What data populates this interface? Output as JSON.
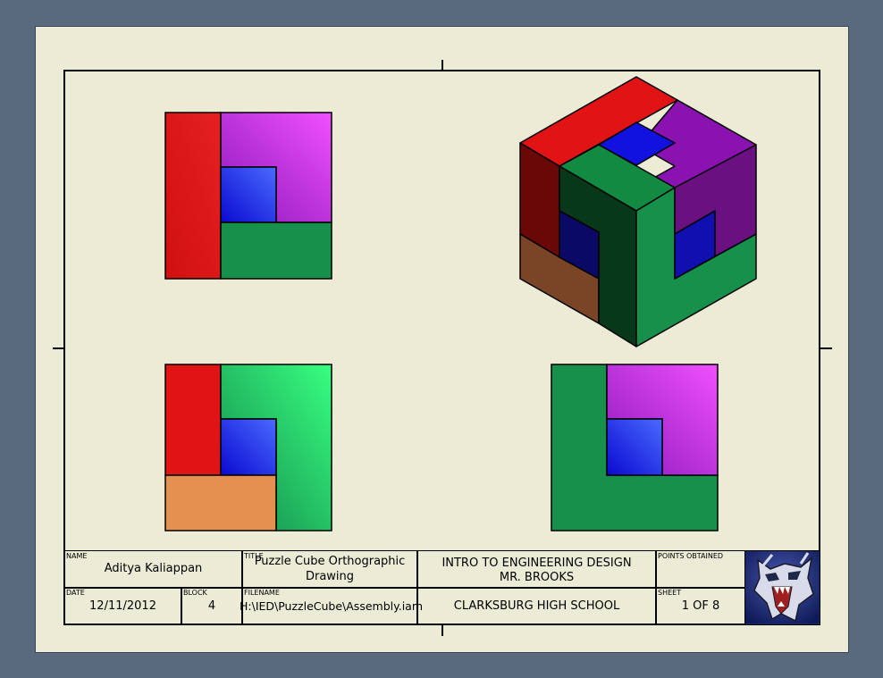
{
  "title_block": {
    "name_caption": "NAME",
    "name": "Aditya Kaliappan",
    "title_caption": "TITLE",
    "title_line1": "Puzzle Cube Orthographic",
    "title_line2": "Drawing",
    "course_line1": "INTRO TO ENGINEERING DESIGN",
    "course_line2": "MR. BROOKS",
    "points_caption": "POINTS OBTAINED",
    "date_caption": "DATE",
    "date": "12/11/2012",
    "block_caption": "BLOCK",
    "block": "4",
    "filename_caption": "FILENAME",
    "filename": "H:\\IED\\PuzzleCube\\Assembly.iam",
    "school": "CLARKSBURG HIGH SCHOOL",
    "sheet_caption": "SHEET",
    "sheet_number": "1",
    "sheet_of": "OF 8"
  },
  "colors": {
    "background": "#5a6a7e",
    "paper": "#ecebd6",
    "red": "#e01414",
    "purple": "#b020d0",
    "blue": "#1010d8",
    "green": "#16904a",
    "orange": "#e39050",
    "brown": "#7a4426"
  }
}
